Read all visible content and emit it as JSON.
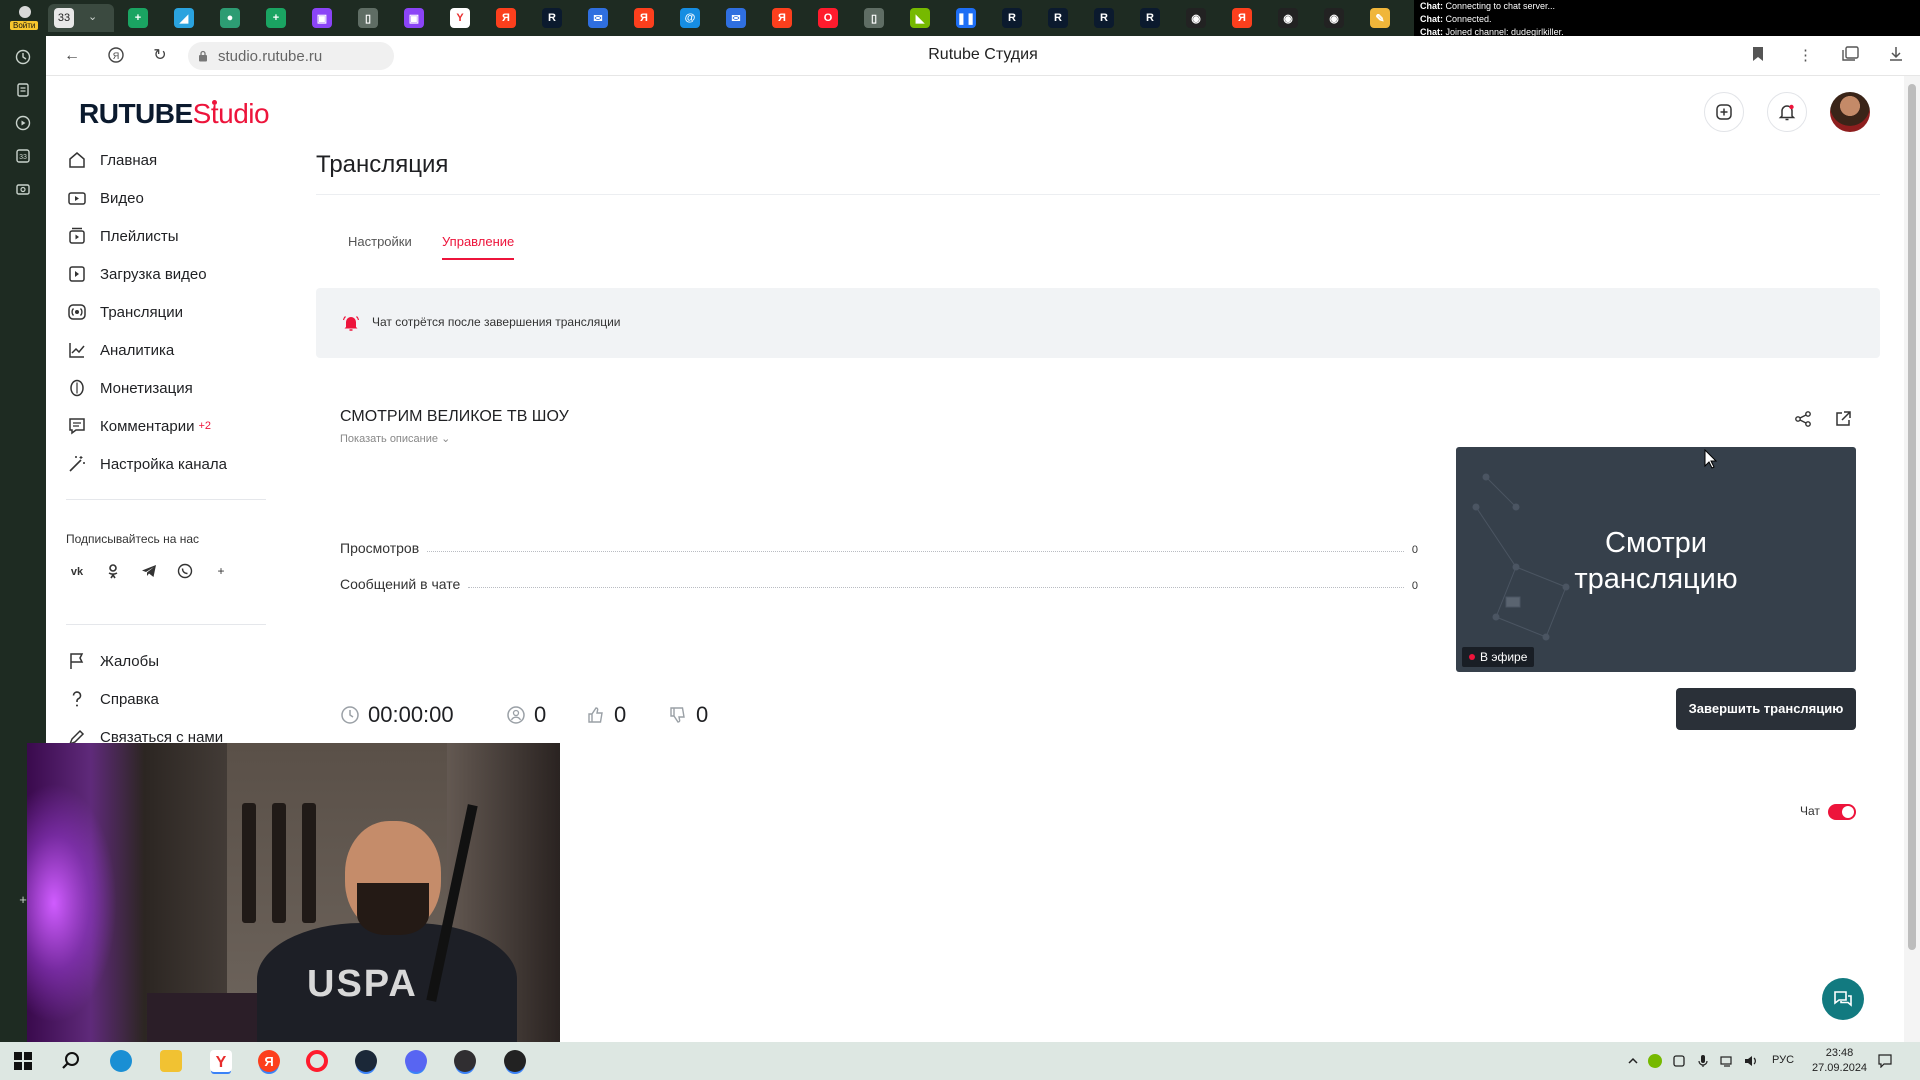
{
  "browser": {
    "login_label": "Войти",
    "tab_count": "33",
    "url": "studio.rutube.ru",
    "page_title": "Rutube Студия",
    "favicons": [
      {
        "name": "sheets-favicon",
        "color": "#1aa462",
        "glyph": "+"
      },
      {
        "name": "telegram-favicon",
        "color": "#2aa3df",
        "glyph": "◢"
      },
      {
        "name": "globe-favicon",
        "color": "#2d9c73",
        "glyph": "●"
      },
      {
        "name": "sheets-favicon",
        "color": "#1aa462",
        "glyph": "+"
      },
      {
        "name": "twitch-favicon",
        "color": "#8b44f7",
        "glyph": "▣"
      },
      {
        "name": "doc-favicon",
        "color": "#5f6d64",
        "glyph": "▯"
      },
      {
        "name": "twitch-favicon",
        "color": "#8b44f7",
        "glyph": "▣"
      },
      {
        "name": "yandex-browser-favicon",
        "color": "#ffffff",
        "glyph": "Y"
      },
      {
        "name": "yandex-favicon",
        "color": "#fc3f1d",
        "glyph": "Я"
      },
      {
        "name": "rutube-favicon",
        "color": "#0b1a2e",
        "glyph": "R"
      },
      {
        "name": "mail-favicon",
        "color": "#2f6fe0",
        "glyph": "✉"
      },
      {
        "name": "yandex-favicon",
        "color": "#fc3f1d",
        "glyph": "Я"
      },
      {
        "name": "mailru-favicon",
        "color": "#168de2",
        "glyph": "@"
      },
      {
        "name": "mail-favicon",
        "color": "#2f6fe0",
        "glyph": "✉"
      },
      {
        "name": "yandex-favicon",
        "color": "#fc3f1d",
        "glyph": "Я"
      },
      {
        "name": "opera-favicon",
        "color": "#ff1b2d",
        "glyph": "O"
      },
      {
        "name": "doc-favicon",
        "color": "#5f6d64",
        "glyph": "▯"
      },
      {
        "name": "nvidia-favicon",
        "color": "#76b900",
        "glyph": "◣"
      },
      {
        "name": "pause-favicon",
        "color": "#1d6ef5",
        "glyph": "❚❚"
      },
      {
        "name": "rutube-favicon",
        "color": "#0b1a2e",
        "glyph": "R"
      },
      {
        "name": "rutube-favicon",
        "color": "#0b1a2e",
        "glyph": "R"
      },
      {
        "name": "rutube-favicon",
        "color": "#0b1a2e",
        "glyph": "R"
      },
      {
        "name": "rutube-favicon",
        "color": "#0b1a2e",
        "glyph": "R"
      },
      {
        "name": "ball-favicon",
        "color": "#222222",
        "glyph": "◉"
      },
      {
        "name": "yandex-favicon",
        "color": "#fc3f1d",
        "glyph": "Я"
      },
      {
        "name": "ball-favicon",
        "color": "#222222",
        "glyph": "◉"
      },
      {
        "name": "ball-favicon",
        "color": "#222222",
        "glyph": "◉"
      },
      {
        "name": "pencil-favicon",
        "color": "#f0b63a",
        "glyph": "✎"
      }
    ]
  },
  "chat_log": [
    {
      "prefix": "Chat:",
      "text": " Connecting to chat server..."
    },
    {
      "prefix": "Chat:",
      "text": " Connected."
    },
    {
      "prefix": "Chat:",
      "text": " Joined channel: dudegirlkiller."
    }
  ],
  "app": {
    "logo_main": "RUTUBE",
    "logo_sub": "Studio",
    "brand_color": "#ed143b",
    "sidebar": [
      {
        "name": "home",
        "label": "Главная",
        "icon": "home-icon"
      },
      {
        "name": "video",
        "label": "Видео",
        "icon": "video-icon"
      },
      {
        "name": "playlists",
        "label": "Плейлисты",
        "icon": "playlist-icon"
      },
      {
        "name": "upload",
        "label": "Загрузка видео",
        "icon": "upload-icon"
      },
      {
        "name": "streams",
        "label": "Трансляции",
        "icon": "broadcast-icon"
      },
      {
        "name": "analytics",
        "label": "Аналитика",
        "icon": "analytics-icon"
      },
      {
        "name": "monetization",
        "label": "Монетизация",
        "icon": "coin-icon"
      },
      {
        "name": "comments",
        "label": "Комментарии",
        "badge": "+2",
        "icon": "comments-icon"
      },
      {
        "name": "channel-settings",
        "label": "Настройка канала",
        "icon": "magic-wand-icon"
      }
    ],
    "follow_title": "Подписывайтесь на нас",
    "socials": [
      "vk-icon",
      "odnoklassniki-icon",
      "telegram-icon",
      "viber-icon",
      "plus-icon"
    ],
    "sidebar_bottom": [
      {
        "name": "complaints",
        "label": "Жалобы",
        "icon": "flag-icon"
      },
      {
        "name": "help",
        "label": "Справка",
        "icon": "question-icon"
      },
      {
        "name": "contact",
        "label": "Связаться с нами",
        "icon": "pen-icon"
      }
    ]
  },
  "page": {
    "title": "Трансляция",
    "tabs": [
      {
        "label": "Настройки",
        "active": false
      },
      {
        "label": "Управление",
        "active": true
      }
    ],
    "notice": "Чат сотрётся после завершения трансляции",
    "stream": {
      "title": "СМОТРИМ ВЕЛИКОЕ ТВ ШОУ",
      "show_description": "Показать описание",
      "stats": [
        {
          "label": "Просмотров",
          "value": "0"
        },
        {
          "label": "Сообщений в чате",
          "value": "0"
        }
      ],
      "preview_line1": "Смотри",
      "preview_line2": "трансляцию",
      "live_badge": "В эфире",
      "duration": "00:00:00",
      "viewers": "0",
      "likes": "0",
      "dislikes": "0",
      "end_button": "Завершить трансляцию"
    },
    "chat_toggle_label": "Чат",
    "chat_enabled": true
  },
  "taskbar": {
    "lang": "РУС",
    "time": "23:48",
    "date": "27.09.2024"
  }
}
